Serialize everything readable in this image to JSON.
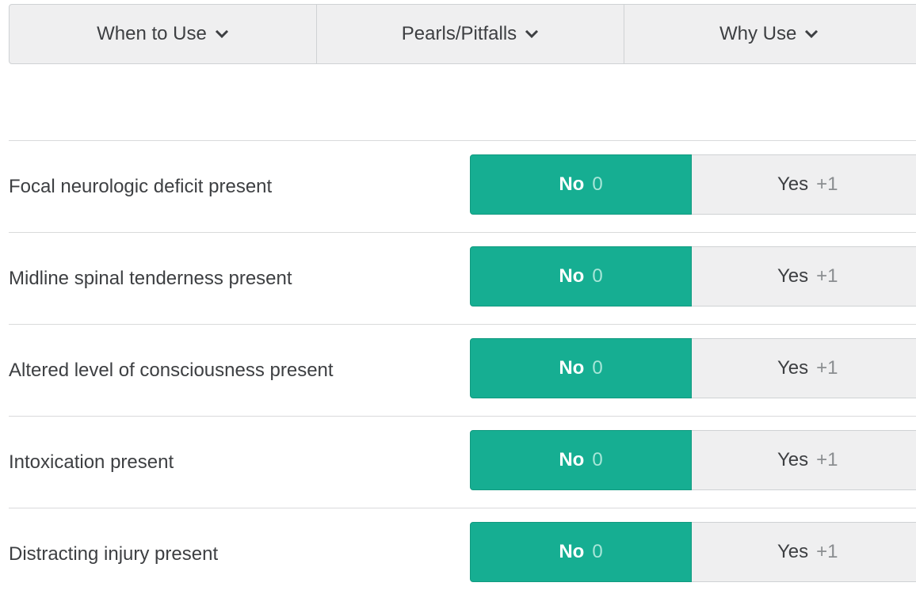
{
  "tabs": [
    {
      "label": "When to Use",
      "icon": "chevron-down-icon"
    },
    {
      "label": "Pearls/Pitfalls",
      "icon": "chevron-down-icon"
    },
    {
      "label": "Why Use",
      "icon": "chevron-down-icon"
    }
  ],
  "criteria": [
    {
      "label": "Focal neurologic deficit present",
      "no_label": "No",
      "no_points": "0",
      "yes_label": "Yes",
      "yes_points": "+1",
      "selected": "No"
    },
    {
      "label": "Midline spinal tenderness present",
      "no_label": "No",
      "no_points": "0",
      "yes_label": "Yes",
      "yes_points": "+1",
      "selected": "No"
    },
    {
      "label": "Altered level of consciousness present",
      "no_label": "No",
      "no_points": "0",
      "yes_label": "Yes",
      "yes_points": "+1",
      "selected": "No"
    },
    {
      "label": "Intoxication present",
      "no_label": "No",
      "no_points": "0",
      "yes_label": "Yes",
      "yes_points": "+1",
      "selected": "No"
    },
    {
      "label": "Distracting injury present",
      "no_label": "No",
      "no_points": "0",
      "yes_label": "Yes",
      "yes_points": "+1",
      "selected": "No"
    }
  ],
  "colors": {
    "selected": "#16ae92",
    "unselected": "#efeff0",
    "text": "#3d3f42"
  }
}
